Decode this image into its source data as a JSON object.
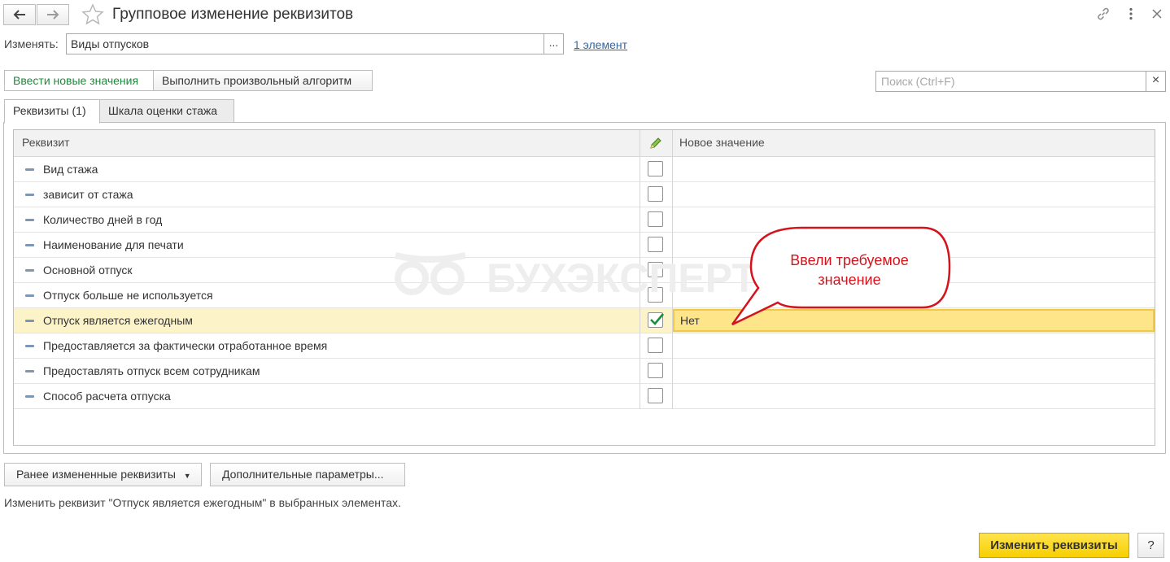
{
  "window": {
    "title": "Групповое изменение реквизитов",
    "back_icon": "arrow-left-icon",
    "forward_icon": "arrow-right-icon",
    "favorite_icon": "star-icon",
    "link_icon": "link-icon",
    "more_icon": "more-vertical-icon",
    "close_icon": "close-icon"
  },
  "change_field": {
    "label": "Изменять:",
    "value": "Виды отпусков",
    "select_button": "...",
    "count_link": "1 элемент"
  },
  "mode_buttons": {
    "enter_new_values": "Ввести новые значения",
    "run_algorithm": "Выполнить произвольный алгоритм"
  },
  "search": {
    "placeholder": "Поиск (Ctrl+F)",
    "clear": "×"
  },
  "tabs": [
    {
      "label": "Реквизиты (1)",
      "active": true
    },
    {
      "label": "Шкала оценки стажа",
      "active": false
    }
  ],
  "table": {
    "columns": {
      "attribute": "Реквизит",
      "edit_icon": "pencil-icon",
      "new_value": "Новое значение"
    },
    "rows": [
      {
        "label": "Вид стажа",
        "checked": false,
        "value": ""
      },
      {
        "label": "зависит от стажа",
        "checked": false,
        "value": ""
      },
      {
        "label": "Количество дней в год",
        "checked": false,
        "value": ""
      },
      {
        "label": "Наименование для печати",
        "checked": false,
        "value": ""
      },
      {
        "label": "Основной отпуск",
        "checked": false,
        "value": ""
      },
      {
        "label": "Отпуск больше не используется",
        "checked": false,
        "value": ""
      },
      {
        "label": "Отпуск является ежегодным",
        "checked": true,
        "value": "Нет",
        "selected": true
      },
      {
        "label": "Предоставляется за фактически отработанное время",
        "checked": false,
        "value": ""
      },
      {
        "label": "Предоставлять отпуск всем сотрудникам",
        "checked": false,
        "value": ""
      },
      {
        "label": "Способ расчета отпуска",
        "checked": false,
        "value": ""
      }
    ]
  },
  "watermark": "БУХЭКСПЕРТ",
  "callout": {
    "line1": "Ввели требуемое",
    "line2": "значение",
    "color": "#d4141d"
  },
  "footer": {
    "previous_button": "Ранее измененные реквизиты",
    "extra_button": "Дополнительные параметры...",
    "description": "Изменить реквизит \"Отпуск является ежегодным\" в выбранных элементах.",
    "apply_button": "Изменить реквизиты",
    "help_button": "?"
  },
  "colors": {
    "accent_yellow": "#f7cf00",
    "selected_row": "#fdf3c8",
    "active_green": "#1e8a3c",
    "link_blue": "#3465a4"
  }
}
